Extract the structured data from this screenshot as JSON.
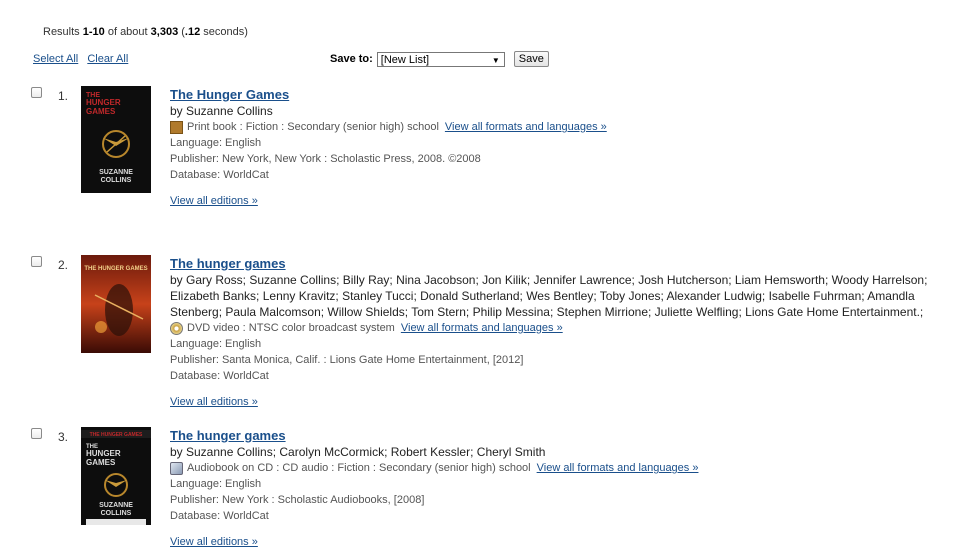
{
  "summary": {
    "prefix": "Results ",
    "range": "1-10",
    "mid": " of about ",
    "total": "3,303",
    "time_prefix": " (",
    "time": ".12",
    "time_suffix": " seconds)"
  },
  "select_all": "Select All",
  "clear_all": "Clear All",
  "save_to": {
    "label": "Save to:",
    "selected": "[New List]",
    "button": "Save"
  },
  "results": [
    {
      "number": "1.",
      "title": "The Hunger Games",
      "authors": "by Suzanne Collins",
      "format": "Print book : Fiction : Secondary (senior high) school",
      "format_icon": "book-icon",
      "view_formats": "View all formats and languages »",
      "language": "Language: English",
      "publisher": "Publisher: New York, New York : Scholastic Press, 2008. ©2008",
      "database": "Database: WorldCat",
      "view_editions": "View all editions »",
      "cover_text": [
        "THE",
        "HUNGER",
        "GAMES",
        "SUZANNE",
        "COLLINS"
      ]
    },
    {
      "number": "2.",
      "title": "The hunger games",
      "authors": "by Gary Ross; Suzanne Collins; Billy Ray; Nina Jacobson; Jon Kilik; Jennifer Lawrence; Josh Hutcherson; Liam Hemsworth; Woody Harrelson; Elizabeth Banks; Lenny Kravitz; Stanley Tucci; Donald Sutherland; Wes Bentley; Toby Jones; Alexander Ludwig; Isabelle Fuhrman; Amandla Stenberg; Paula Malcomson; Willow Shields; Tom Stern; Philip Messina; Stephen Mirrione; Juliette Welfling; Lions Gate Home Entertainment.;",
      "format": "DVD video : NTSC color broadcast system",
      "format_icon": "dvd-icon",
      "view_formats": "View all formats and languages »",
      "language": "Language: English",
      "publisher": "Publisher: Santa Monica, Calif. : Lions Gate Home Entertainment, [2012]",
      "database": "Database: WorldCat",
      "view_editions": "View all editions »",
      "cover_text": [
        "THE HUNGER GAMES"
      ]
    },
    {
      "number": "3.",
      "title": "The hunger games",
      "authors": "by Suzanne Collins; Carolyn McCormick; Robert Kessler; Cheryl Smith",
      "format": "Audiobook on CD : CD audio : Fiction : Secondary (senior high) school",
      "format_icon": "audiobook-cd-icon",
      "view_formats": "View all formats and languages »",
      "language": "Language: English",
      "publisher": "Publisher: New York : Scholastic Audiobooks, [2008]",
      "database": "Database: WorldCat",
      "view_editions": "View all editions »",
      "cover_text": [
        "THE HUNGER GAMES",
        "THE",
        "HUNGER",
        "GAMES",
        "SUZANNE",
        "COLLINS"
      ]
    }
  ],
  "colors": {
    "link": "#1a4f8b",
    "text": "#333333"
  }
}
